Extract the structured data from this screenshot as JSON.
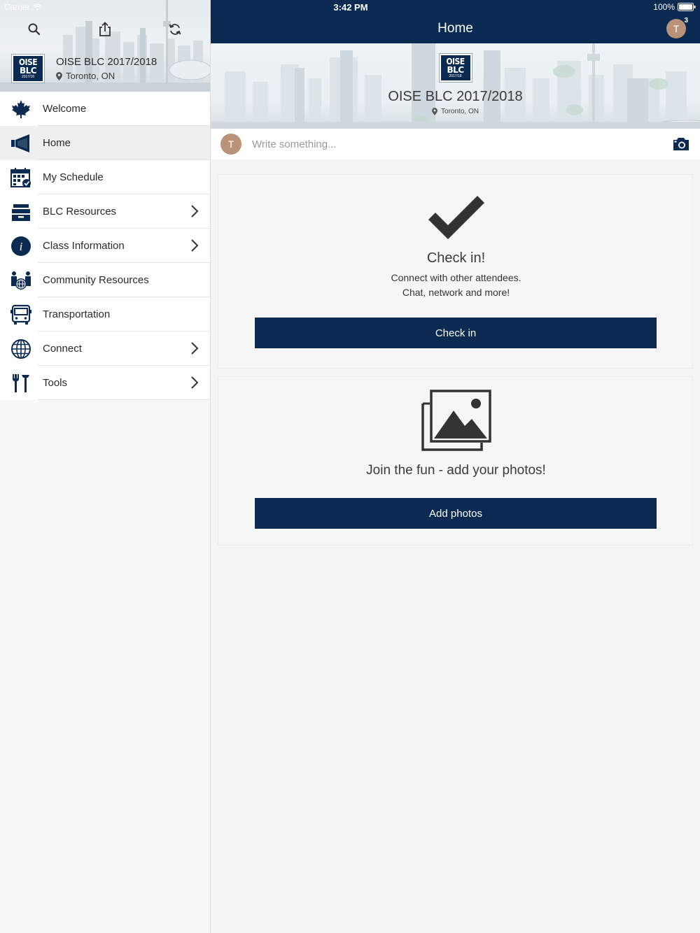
{
  "statusbar": {
    "carrier": "Carrier",
    "time": "3:42 PM",
    "battery": "100%"
  },
  "sidebar": {
    "event": {
      "logo_line1": "OISE",
      "logo_line2": "BLC",
      "logo_line3": "2017/18",
      "title": "OISE BLC 2017/2018",
      "location": "Toronto, ON"
    },
    "tools": [
      "search-icon",
      "share-icon",
      "refresh-icon"
    ],
    "items": [
      {
        "label": "Welcome",
        "icon": "maple-leaf-icon",
        "chevron": false,
        "active": false
      },
      {
        "label": "Home",
        "icon": "megaphone-icon",
        "chevron": false,
        "active": true
      },
      {
        "label": "My Schedule",
        "icon": "calendar-check-icon",
        "chevron": false,
        "active": false
      },
      {
        "label": "BLC Resources",
        "icon": "archive-box-icon",
        "chevron": true,
        "active": false
      },
      {
        "label": "Class Information",
        "icon": "info-icon",
        "chevron": true,
        "active": false
      },
      {
        "label": "Community Resources",
        "icon": "community-globe-icon",
        "chevron": false,
        "active": false
      },
      {
        "label": "Transportation",
        "icon": "bus-icon",
        "chevron": false,
        "active": false
      },
      {
        "label": "Connect",
        "icon": "globe-icon",
        "chevron": true,
        "active": false
      },
      {
        "label": "Tools",
        "icon": "tools-icon",
        "chevron": true,
        "active": false
      }
    ]
  },
  "header": {
    "title": "Home",
    "avatar_initial": "T",
    "notification_count": "3"
  },
  "banner": {
    "logo_line1": "OISE",
    "logo_line2": "BLC",
    "logo_line3": "2017/18",
    "title": "OISE BLC 2017/2018",
    "location": "Toronto, ON"
  },
  "composer": {
    "avatar_initial": "T",
    "placeholder": "Write something..."
  },
  "checkin_card": {
    "title": "Check in!",
    "line1": "Connect with other attendees.",
    "line2": "Chat, network and more!",
    "button": "Check in"
  },
  "photos_card": {
    "title": "Join the fun - add your photos!",
    "button": "Add photos"
  },
  "colors": {
    "navy": "#0b2a52",
    "avatar": "#b99278",
    "background": "#f5f5f5"
  }
}
